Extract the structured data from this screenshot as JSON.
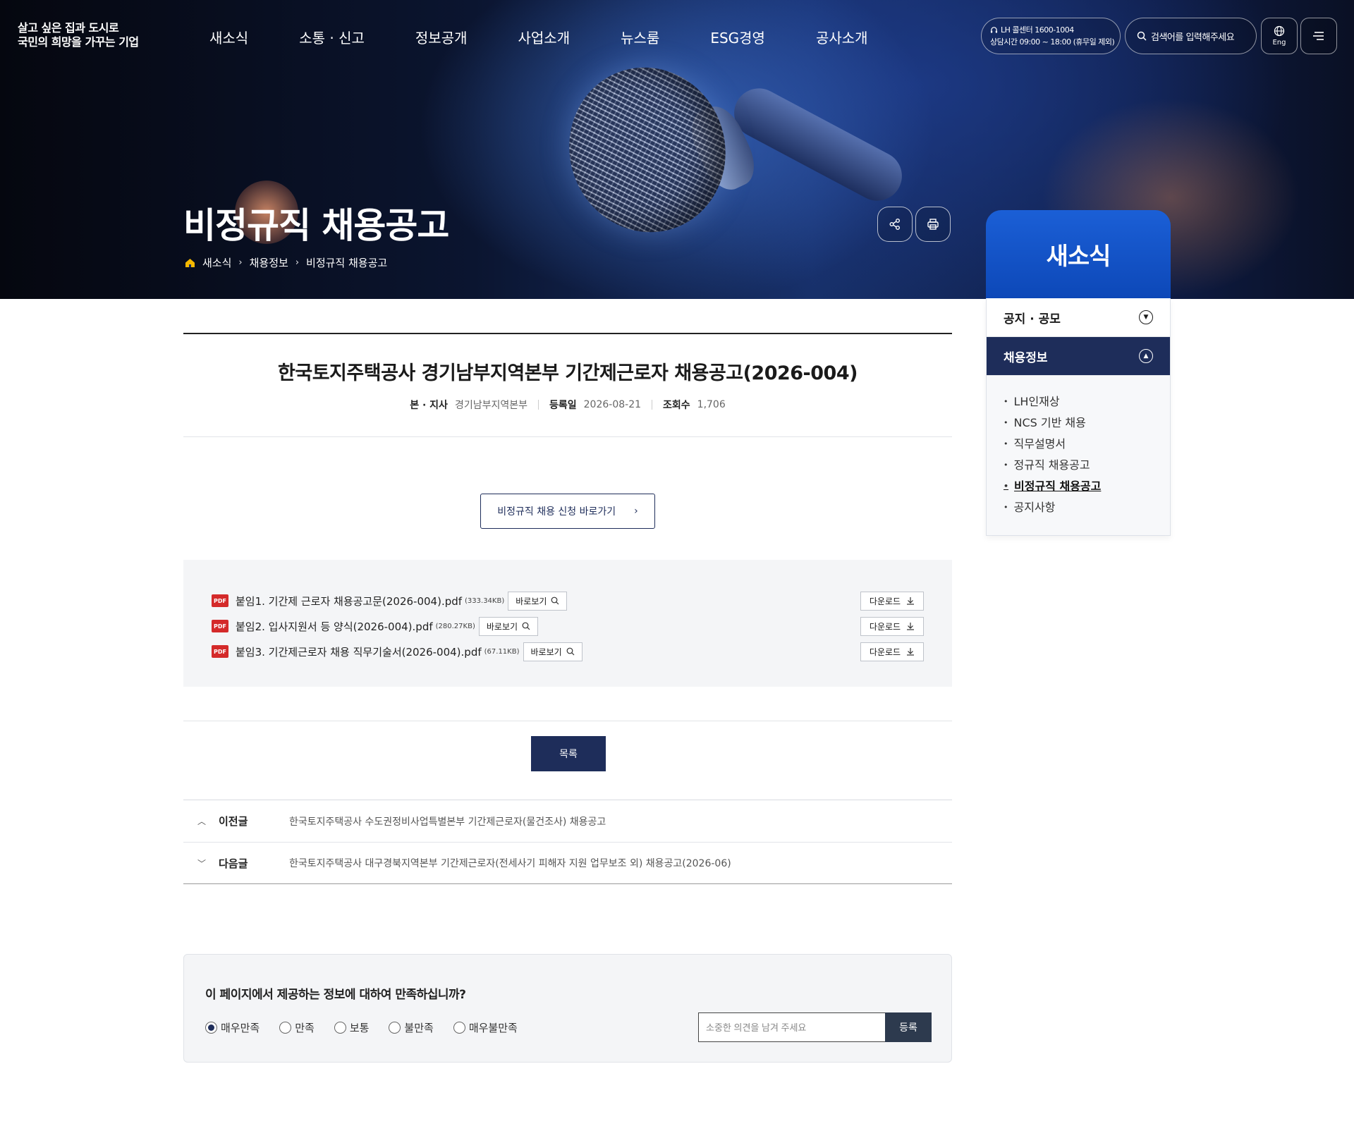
{
  "header": {
    "logo_line1": "살고 싶은 집과 도시로",
    "logo_line2": "국민의 희망을 가꾸는 기업",
    "nav": [
      "새소식",
      "소통 · 신고",
      "정보공개",
      "사업소개",
      "뉴스룸",
      "ESG경영",
      "공사소개"
    ],
    "callcenter_line1": "LH 콜센터 1600-1004",
    "callcenter_line2": "상담시간 09:00 ~ 18:00 (휴무일 제외)",
    "search_placeholder": "검색어를 입력해주세요",
    "lang_label": "Eng"
  },
  "hero": {
    "title": "비정규직 채용공고",
    "breadcrumb": [
      "새소식",
      "채용정보",
      "비정규직 채용공고"
    ]
  },
  "side": {
    "title": "새소식",
    "categories": [
      {
        "label": "공지 · 공모",
        "state": "collapsed"
      },
      {
        "label": "채용정보",
        "state": "expanded"
      }
    ],
    "sub_items": [
      "LH인재상",
      "NCS 기반 채용",
      "직무설명서",
      "정규직 채용공고",
      "비정규직 채용공고",
      "공지사항"
    ],
    "current_item": "비정규직 채용공고"
  },
  "article": {
    "title": "한국토지주택공사 경기남부지역본부 기간제근로자 채용공고(2026-004)",
    "meta": {
      "branch_label": "본 · 지사",
      "branch_value": "경기남부지역본부",
      "date_label": "등록일",
      "date_value": "2026-08-21",
      "views_label": "조회수",
      "views_value": "1,706"
    },
    "apply_button": "비정규직 채용 신청 바로가기",
    "files": [
      {
        "name": "붙임1. 기간제 근로자 채용공고문(2026-004).pdf",
        "size": "(333.34KB)"
      },
      {
        "name": "붙임2. 입사지원서 등 양식(2026-004).pdf",
        "size": "(280.27KB)"
      },
      {
        "name": "붙임3. 기간제근로자 채용 직무기술서(2026-004).pdf",
        "size": "(67.11KB)"
      }
    ],
    "file_icon_label": "PDF",
    "view_label": "바로보기",
    "download_label": "다운로드",
    "list_button": "목록",
    "prev_label": "이전글",
    "prev_title": "한국토지주택공사 수도권정비사업특별본부 기간제근로자(물건조사) 채용공고",
    "next_label": "다음글",
    "next_title": "한국토지주택공사 대구경북지역본부 기간제근로자(전세사기 피해자 지원 업무보조 외) 채용공고(2026-06)"
  },
  "survey": {
    "question": "이 페이지에서 제공하는 정보에 대하여 만족하십니까?",
    "options": [
      "매우만족",
      "만족",
      "보통",
      "불만족",
      "매우불만족"
    ],
    "selected": "매우만족",
    "input_placeholder": "소중한 의견을 남겨 주세요",
    "submit": "등록"
  },
  "colors": {
    "navy": "#1e2d5a",
    "side_blue": "#1b5fd6",
    "pdf_red": "#d42a2a"
  }
}
